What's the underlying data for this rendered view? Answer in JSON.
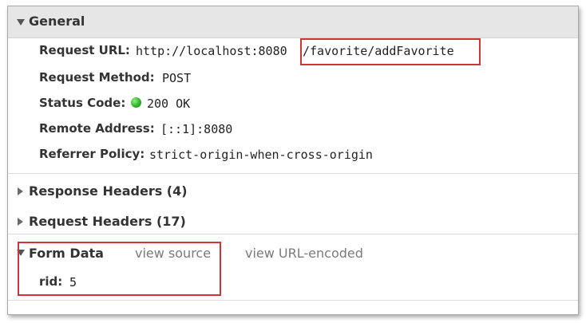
{
  "general": {
    "title": "General",
    "request_url_label": "Request URL:",
    "request_url_host": "http://localhost:8080",
    "request_url_path": "/favorite/addFavorite",
    "request_method_label": "Request Method:",
    "request_method_value": "POST",
    "status_code_label": "Status Code:",
    "status_code_value": "200 OK",
    "status_color": "#2fb52a",
    "remote_address_label": "Remote Address:",
    "remote_address_value": "[::1]:8080",
    "referrer_policy_label": "Referrer Policy:",
    "referrer_policy_value": "strict-origin-when-cross-origin"
  },
  "response_headers": {
    "title": "Response Headers (4)"
  },
  "request_headers": {
    "title": "Request Headers (17)"
  },
  "form_data": {
    "title": "Form Data",
    "view_source": "view source",
    "view_url_encoded": "view URL-encoded",
    "fields": [
      {
        "name": "rid:",
        "value": "5"
      }
    ]
  },
  "highlight_color": "#d0343a"
}
